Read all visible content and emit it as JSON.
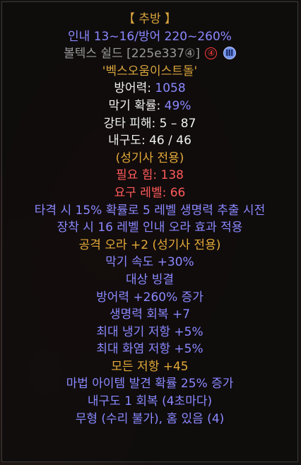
{
  "tooltip": {
    "category_line": "【 추방 】",
    "roll_range": "인내 13~16/방어 220~260%",
    "base_name": "볼텍스 쉴드",
    "base_code": "[225e337④]",
    "socket_badge": "④",
    "tier_badge": "Ⅲ",
    "runeword_name": "'벡스오움이스트돌'",
    "stats": {
      "defense_label": "방어력: ",
      "defense_value": "1058",
      "block_label": "막기 확률: ",
      "block_value": "49%",
      "smite_damage": "강타 피해: 5 – 87",
      "durability": "내구도: 46 / 46",
      "class_restriction": "(성기사 전용)",
      "required_str": "필요 힘: 138",
      "required_level": "요구 레벨: 66"
    },
    "mods": [
      {
        "text": "타격 시 15% 확률로 5 레벨 생명력 추출 시전",
        "color": "blue"
      },
      {
        "text": "장착 시 16 레벨 인내 오라 효과 적용",
        "color": "blue"
      },
      {
        "text": "공격 오라 +2 (성기사 전용)",
        "color": "orange"
      },
      {
        "text": "막기 속도 +30%",
        "color": "blue"
      },
      {
        "text": "대상 빙결",
        "color": "blue"
      },
      {
        "text": "방어력 +260% 증가",
        "color": "blue"
      },
      {
        "text": "생명력 회복 +7",
        "color": "blue"
      },
      {
        "text": "최대 냉기 저항 +5%",
        "color": "blue"
      },
      {
        "text": "최대 화염 저항 +5%",
        "color": "blue"
      },
      {
        "text": "모든 저항 +45",
        "color": "orange"
      },
      {
        "text": "마법 아이템 발견 확률 25% 증가",
        "color": "blue"
      },
      {
        "text": "내구도 1 회복 (4초마다)",
        "color": "blue"
      },
      {
        "text": "무형 (수리 불가), 홈 있음 (4)",
        "color": "blue"
      }
    ]
  },
  "colors": {
    "gold": "#d7a43c",
    "blue": "#8a88ff",
    "grey": "#9a9a9a",
    "red": "#ff5a5a",
    "orange": "#e3aa38"
  }
}
